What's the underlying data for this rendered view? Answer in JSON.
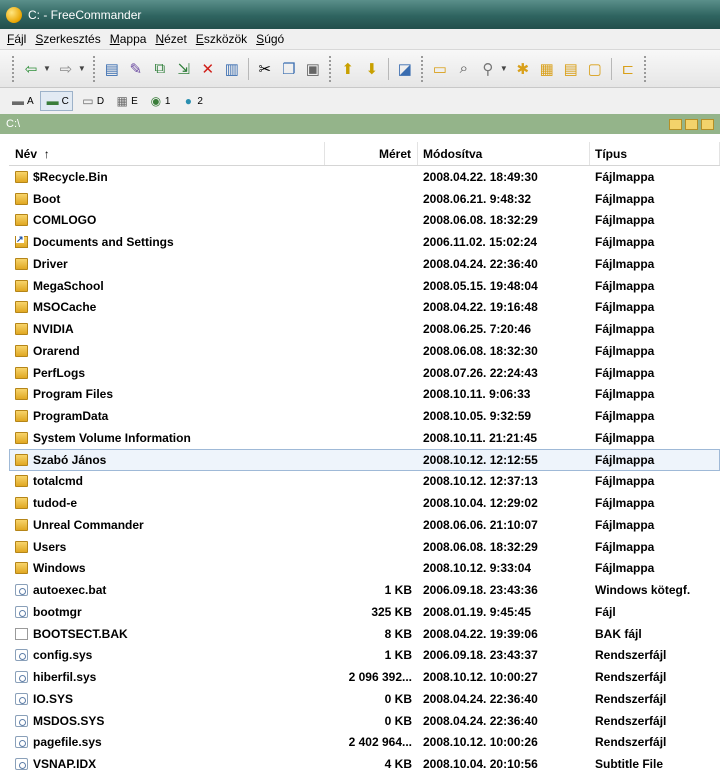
{
  "window": {
    "title": "C: - FreeCommander"
  },
  "menu": [
    {
      "label": "Fájl",
      "u": "F",
      "rest": "ájl"
    },
    {
      "label": "Szerkesztés",
      "u": "S",
      "rest": "zerkesztés"
    },
    {
      "label": "Mappa",
      "u": "M",
      "rest": "appa"
    },
    {
      "label": "Nézet",
      "u": "N",
      "rest": "ézet"
    },
    {
      "label": "Eszközök",
      "u": "E",
      "rest": "szközök"
    },
    {
      "label": "Súgó",
      "u": "S",
      "rest": "úgó"
    }
  ],
  "drives": [
    {
      "letter": "A",
      "icon": "floppy-drive-icon",
      "active": false
    },
    {
      "letter": "C",
      "icon": "system-drive-icon",
      "active": true
    },
    {
      "letter": "D",
      "icon": "optical-drive-icon",
      "active": false
    },
    {
      "letter": "E",
      "icon": "printer-drive-icon",
      "active": false
    },
    {
      "letter": "1",
      "icon": "network-drive-icon",
      "active": false
    },
    {
      "letter": "2",
      "icon": "ftp-drive-icon",
      "active": false
    }
  ],
  "path": "C:\\",
  "columns": {
    "name": "Név",
    "sort_indicator": "↑",
    "size": "Méret",
    "date": "Módosítva",
    "type": "Típus"
  },
  "files": [
    {
      "name": "$Recycle.Bin",
      "size": "",
      "date": "2008.04.22. 18:49:30",
      "type": "Fájlmappa",
      "icon": "folder"
    },
    {
      "name": "Boot",
      "size": "",
      "date": "2008.06.21. 9:48:32",
      "type": "Fájlmappa",
      "icon": "folder"
    },
    {
      "name": "COMLOGO",
      "size": "",
      "date": "2008.06.08. 18:32:29",
      "type": "Fájlmappa",
      "icon": "folder"
    },
    {
      "name": "Documents and Settings",
      "size": "",
      "date": "2006.11.02. 15:02:24",
      "type": "Fájlmappa",
      "icon": "shortcut"
    },
    {
      "name": "Driver",
      "size": "",
      "date": "2008.04.24. 22:36:40",
      "type": "Fájlmappa",
      "icon": "folder"
    },
    {
      "name": "MegaSchool",
      "size": "",
      "date": "2008.05.15. 19:48:04",
      "type": "Fájlmappa",
      "icon": "folder"
    },
    {
      "name": "MSOCache",
      "size": "",
      "date": "2008.04.22. 19:16:48",
      "type": "Fájlmappa",
      "icon": "folder"
    },
    {
      "name": "NVIDIA",
      "size": "",
      "date": "2008.06.25. 7:20:46",
      "type": "Fájlmappa",
      "icon": "folder"
    },
    {
      "name": "Orarend",
      "size": "",
      "date": "2008.06.08. 18:32:30",
      "type": "Fájlmappa",
      "icon": "folder"
    },
    {
      "name": "PerfLogs",
      "size": "",
      "date": "2008.07.26. 22:24:43",
      "type": "Fájlmappa",
      "icon": "folder"
    },
    {
      "name": "Program Files",
      "size": "",
      "date": "2008.10.11. 9:06:33",
      "type": "Fájlmappa",
      "icon": "folder"
    },
    {
      "name": "ProgramData",
      "size": "",
      "date": "2008.10.05. 9:32:59",
      "type": "Fájlmappa",
      "icon": "folder"
    },
    {
      "name": "System Volume Information",
      "size": "",
      "date": "2008.10.11. 21:21:45",
      "type": "Fájlmappa",
      "icon": "folder"
    },
    {
      "name": "Szabó János",
      "size": "",
      "date": "2008.10.12. 12:12:55",
      "type": "Fájlmappa",
      "icon": "folder",
      "selected": true
    },
    {
      "name": "totalcmd",
      "size": "",
      "date": "2008.10.12. 12:37:13",
      "type": "Fájlmappa",
      "icon": "folder"
    },
    {
      "name": "tudod-e",
      "size": "",
      "date": "2008.10.04. 12:29:02",
      "type": "Fájlmappa",
      "icon": "folder"
    },
    {
      "name": "Unreal Commander",
      "size": "",
      "date": "2008.06.06. 21:10:07",
      "type": "Fájlmappa",
      "icon": "folder"
    },
    {
      "name": "Users",
      "size": "",
      "date": "2008.06.08. 18:32:29",
      "type": "Fájlmappa",
      "icon": "folder"
    },
    {
      "name": "Windows",
      "size": "",
      "date": "2008.10.12. 9:33:04",
      "type": "Fájlmappa",
      "icon": "folder"
    },
    {
      "name": "autoexec.bat",
      "size": "1 KB",
      "date": "2006.09.18. 23:43:36",
      "type": "Windows kötegf.",
      "icon": "sysfile"
    },
    {
      "name": "bootmgr",
      "size": "325 KB",
      "date": "2008.01.19. 9:45:45",
      "type": "Fájl",
      "icon": "sysfile"
    },
    {
      "name": "BOOTSECT.BAK",
      "size": "8 KB",
      "date": "2008.04.22. 19:39:06",
      "type": "BAK fájl",
      "icon": "blank"
    },
    {
      "name": "config.sys",
      "size": "1 KB",
      "date": "2006.09.18. 23:43:37",
      "type": "Rendszerfájl",
      "icon": "sysfile"
    },
    {
      "name": "hiberfil.sys",
      "size": "2 096 392...",
      "date": "2008.10.12. 10:00:27",
      "type": "Rendszerfájl",
      "icon": "sysfile"
    },
    {
      "name": "IO.SYS",
      "size": "0 KB",
      "date": "2008.04.24. 22:36:40",
      "type": "Rendszerfájl",
      "icon": "sysfile"
    },
    {
      "name": "MSDOS.SYS",
      "size": "0 KB",
      "date": "2008.04.24. 22:36:40",
      "type": "Rendszerfájl",
      "icon": "sysfile"
    },
    {
      "name": "pagefile.sys",
      "size": "2 402 964...",
      "date": "2008.10.12. 10:00:26",
      "type": "Rendszerfájl",
      "icon": "sysfile"
    },
    {
      "name": "VSNAP.IDX",
      "size": "4 KB",
      "date": "2008.10.04. 20:10:56",
      "type": "Subtitle File",
      "icon": "sysfile"
    }
  ]
}
